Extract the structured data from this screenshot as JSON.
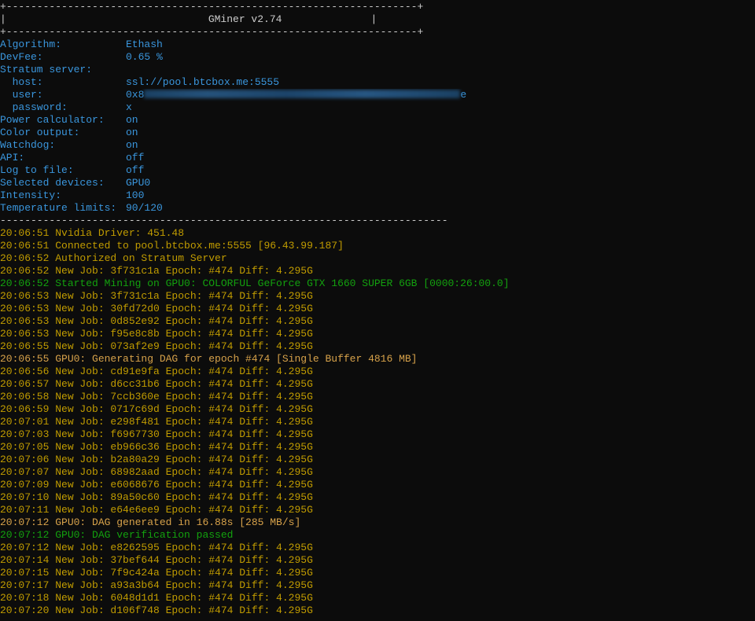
{
  "header": {
    "border_line": "+-------------------------------------------------------------------+",
    "title_left": "|",
    "title": "GMiner v2.74",
    "title_right": "|",
    "separator": "-------------------------------------------------------------------------"
  },
  "config": [
    {
      "key": "Algorithm:",
      "value": "Ethash"
    },
    {
      "key": "DevFee:",
      "value": "0.65 %"
    },
    {
      "key": "Stratum server:",
      "value": ""
    },
    {
      "key": "  host:",
      "value": "ssl://pool.btcbox.me:5555"
    },
    {
      "key": "  user:",
      "value_prefix": "0x8",
      "value_suffix": "e"
    },
    {
      "key": "  password:",
      "value": "x"
    },
    {
      "key": "Power calculator:",
      "value": "on"
    },
    {
      "key": "Color output:",
      "value": "on"
    },
    {
      "key": "Watchdog:",
      "value": "on"
    },
    {
      "key": "API:",
      "value": "off"
    },
    {
      "key": "Log to file:",
      "value": "off"
    },
    {
      "key": "Selected devices:",
      "value": "GPU0"
    },
    {
      "key": "Intensity:",
      "value": "100"
    },
    {
      "key": "Temperature limits:",
      "value": "90/120"
    }
  ],
  "log": [
    {
      "text": "20:06:51 Nvidia Driver: 451.48",
      "color": "orange"
    },
    {
      "text": "20:06:51 Connected to pool.btcbox.me:5555 [96.43.99.187]",
      "color": "orange"
    },
    {
      "text": "20:06:52 Authorized on Stratum Server",
      "color": "orange"
    },
    {
      "text": "20:06:52 New Job: 3f731c1a Epoch: #474 Diff: 4.295G",
      "color": "orange"
    },
    {
      "text": "20:06:52 Started Mining on GPU0: COLORFUL GeForce GTX 1660 SUPER 6GB [0000:26:00.0]",
      "color": "green"
    },
    {
      "text": "20:06:53 New Job: 3f731c1a Epoch: #474 Diff: 4.295G",
      "color": "orange"
    },
    {
      "text": "20:06:53 New Job: 30fd72d0 Epoch: #474 Diff: 4.295G",
      "color": "orange"
    },
    {
      "text": "20:06:53 New Job: 0d852e92 Epoch: #474 Diff: 4.295G",
      "color": "orange"
    },
    {
      "text": "20:06:53 New Job: f95e8c8b Epoch: #474 Diff: 4.295G",
      "color": "orange"
    },
    {
      "text": "20:06:55 New Job: 073af2e9 Epoch: #474 Diff: 4.295G",
      "color": "orange"
    },
    {
      "text": "20:06:55 GPU0: Generating DAG for epoch #474 [Single Buffer 4816 MB]",
      "color": "orange2"
    },
    {
      "text": "20:06:56 New Job: cd91e9fa Epoch: #474 Diff: 4.295G",
      "color": "orange"
    },
    {
      "text": "20:06:57 New Job: d6cc31b6 Epoch: #474 Diff: 4.295G",
      "color": "orange"
    },
    {
      "text": "20:06:58 New Job: 7ccb360e Epoch: #474 Diff: 4.295G",
      "color": "orange"
    },
    {
      "text": "20:06:59 New Job: 0717c69d Epoch: #474 Diff: 4.295G",
      "color": "orange"
    },
    {
      "text": "20:07:01 New Job: e298f481 Epoch: #474 Diff: 4.295G",
      "color": "orange"
    },
    {
      "text": "20:07:03 New Job: f6967730 Epoch: #474 Diff: 4.295G",
      "color": "orange"
    },
    {
      "text": "20:07:05 New Job: eb966c36 Epoch: #474 Diff: 4.295G",
      "color": "orange"
    },
    {
      "text": "20:07:06 New Job: b2a80a29 Epoch: #474 Diff: 4.295G",
      "color": "orange"
    },
    {
      "text": "20:07:07 New Job: 68982aad Epoch: #474 Diff: 4.295G",
      "color": "orange"
    },
    {
      "text": "20:07:09 New Job: e6068676 Epoch: #474 Diff: 4.295G",
      "color": "orange"
    },
    {
      "text": "20:07:10 New Job: 89a50c60 Epoch: #474 Diff: 4.295G",
      "color": "orange"
    },
    {
      "text": "20:07:11 New Job: e64e6ee9 Epoch: #474 Diff: 4.295G",
      "color": "orange"
    },
    {
      "text": "20:07:12 GPU0: DAG generated in 16.88s [285 MB/s]",
      "color": "orange2"
    },
    {
      "text": "20:07:12 GPU0: DAG verification passed",
      "color": "green"
    },
    {
      "text": "20:07:12 New Job: e8262595 Epoch: #474 Diff: 4.295G",
      "color": "orange"
    },
    {
      "text": "20:07:14 New Job: 37bef644 Epoch: #474 Diff: 4.295G",
      "color": "orange"
    },
    {
      "text": "20:07:15 New Job: 7f9c424a Epoch: #474 Diff: 4.295G",
      "color": "orange"
    },
    {
      "text": "20:07:17 New Job: a93a3b64 Epoch: #474 Diff: 4.295G",
      "color": "orange"
    },
    {
      "text": "20:07:18 New Job: 6048d1d1 Epoch: #474 Diff: 4.295G",
      "color": "orange"
    },
    {
      "text": "20:07:20 New Job: d106f748 Epoch: #474 Diff: 4.295G",
      "color": "orange"
    }
  ],
  "colors": {
    "background": "#0c0c0c",
    "config_blue": "#3a96dd",
    "log_orange": "#c19c00",
    "log_orange_dag": "#d7a24a",
    "log_green": "#13a10e",
    "border_gray": "#cccccc"
  }
}
